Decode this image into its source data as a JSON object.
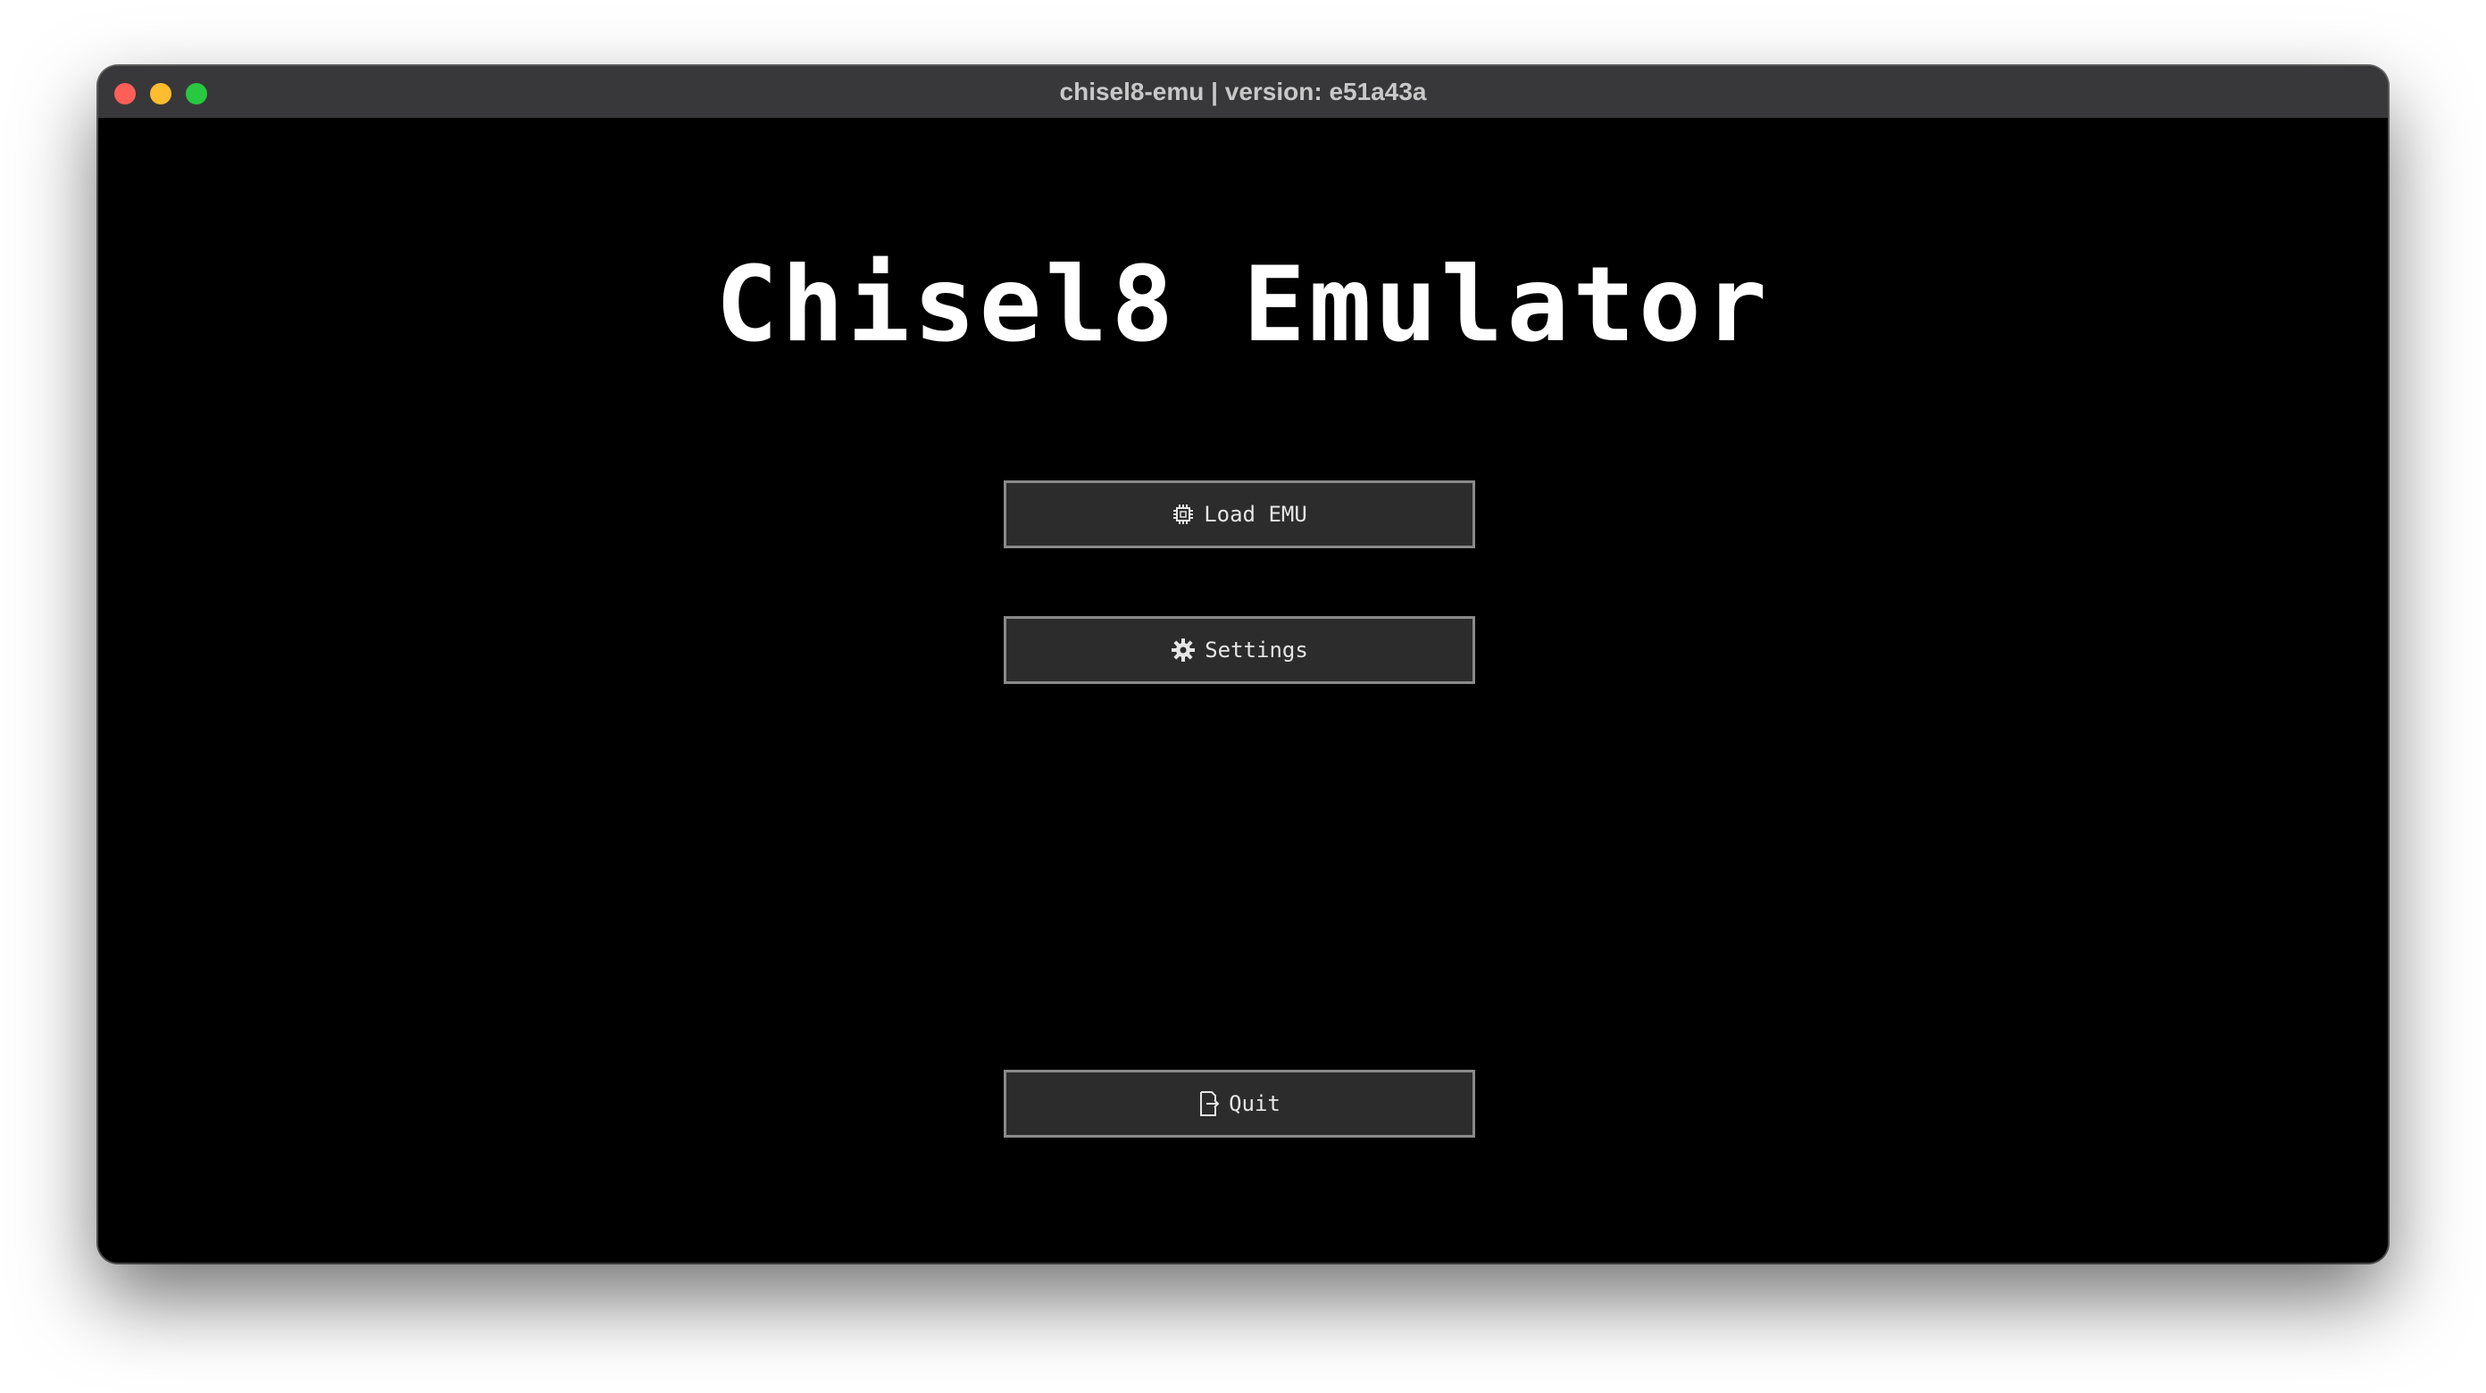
{
  "window": {
    "title": "chisel8-emu | version: e51a43a"
  },
  "app": {
    "title": "Chisel8 Emulator"
  },
  "menu": {
    "load": {
      "label": "Load EMU",
      "icon": "chip-icon"
    },
    "settings": {
      "label": "Settings",
      "icon": "gear-icon"
    },
    "quit": {
      "label": "Quit",
      "icon": "exit-door-icon"
    }
  },
  "colors": {
    "background": "#000000",
    "button_bg": "#2c2c2c",
    "button_border": "#8a8a8a",
    "title_text": "#ffffff"
  }
}
